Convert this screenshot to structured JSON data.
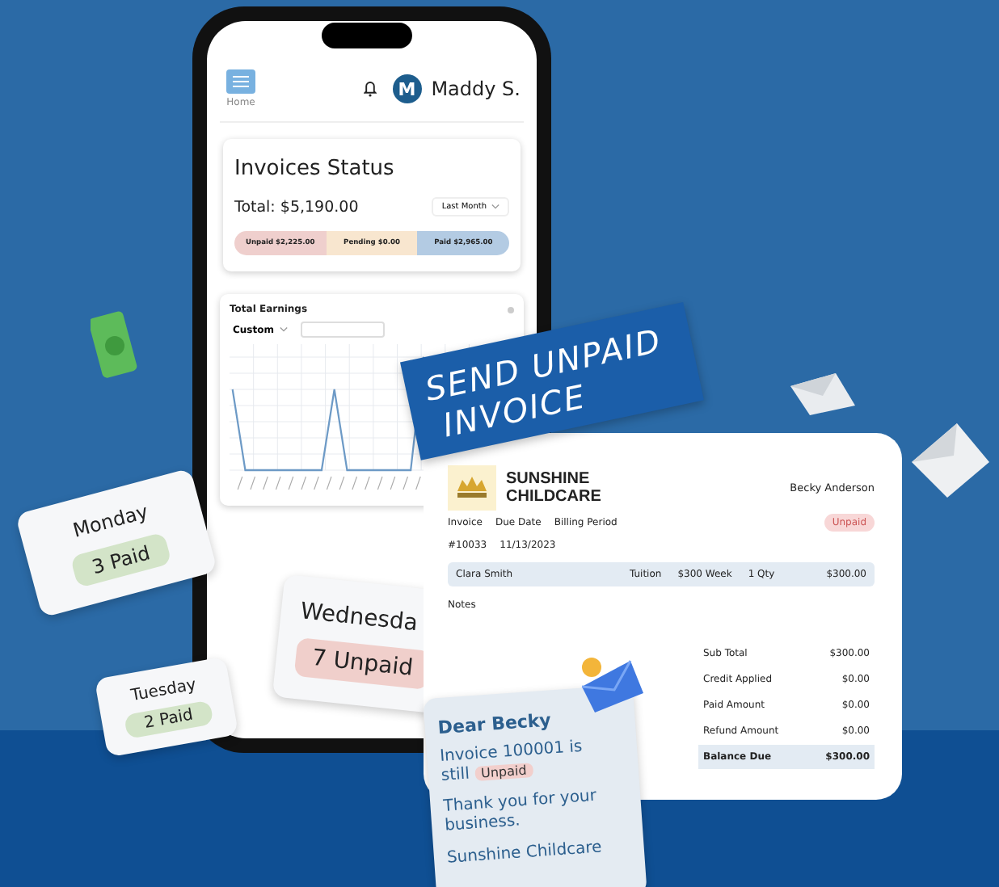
{
  "phone": {
    "menu_label": "Home",
    "user": {
      "initial": "M",
      "name": "Maddy S."
    },
    "status_card": {
      "title": "Invoices Status",
      "total": "Total: $5,190.00",
      "period": "Last Month",
      "segments": [
        {
          "label": "Unpaid $2,225.00",
          "color": "#efcfcd"
        },
        {
          "label": "Pending $0.00",
          "color": "#f8e6cf"
        },
        {
          "label": "Paid $2,965.00",
          "color": "#b3cbe3"
        }
      ]
    },
    "earnings_card": {
      "title": "Total Earnings",
      "range": "Custom"
    }
  },
  "banner": [
    "SEND UNPAID",
    "INVOICE"
  ],
  "invoice": {
    "company": [
      "SUNSHINE",
      "CHILDCARE"
    ],
    "customer": "Becky Anderson",
    "status": "Unpaid",
    "headers": [
      "Invoice",
      "Due Date",
      "Billing Period"
    ],
    "values": [
      "#10033",
      "11/13/2023"
    ],
    "line_item": [
      "Clara Smith",
      "Tuition",
      "$300 Week",
      "1 Qty",
      "$300.00"
    ],
    "notes_label": "Notes",
    "summary": [
      {
        "label": "Sub Total",
        "value": "$300.00",
        "highlight": false
      },
      {
        "label": "Credit Applied",
        "value": "$0.00",
        "highlight": false
      },
      {
        "label": "Paid Amount",
        "value": "$0.00",
        "highlight": false
      },
      {
        "label": "Refund Amount",
        "value": "$0.00",
        "highlight": false
      },
      {
        "label": "Balance Due",
        "value": "$300.00",
        "highlight": true
      }
    ]
  },
  "note": {
    "greeting": "Dear Becky",
    "message": "Invoice 100001 is still",
    "status": "Unpaid",
    "thanks": "Thank you for your business.",
    "signature": "Sunshine Childcare"
  },
  "day_cards": [
    {
      "day": "Monday",
      "count": "3 Paid",
      "kind": "paid"
    },
    {
      "day": "Tuesday",
      "count": "2 Paid",
      "kind": "paid"
    },
    {
      "day": "Wednesda",
      "count": "7 Unpaid",
      "kind": "unpaid"
    }
  ]
}
